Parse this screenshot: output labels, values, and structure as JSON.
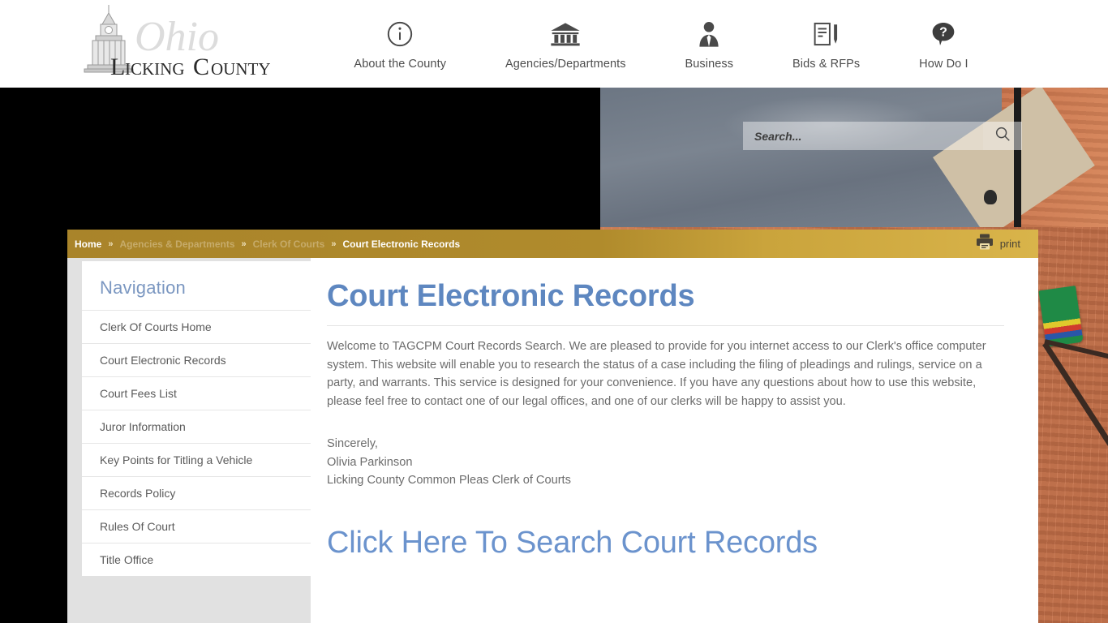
{
  "site": {
    "logo_line1": "Ohio",
    "logo_line2_a": "L",
    "logo_line2_b": "ICKING",
    "logo_line2_c": "C",
    "logo_line2_d": "OUNTY",
    "logo_alt": "Licking County Ohio"
  },
  "topnav": {
    "items": [
      {
        "label": "About the County",
        "icon": "info-circle-icon"
      },
      {
        "label": "Agencies/Departments",
        "icon": "bank-building-icon"
      },
      {
        "label": "Business",
        "icon": "businessperson-icon"
      },
      {
        "label": "Bids & RFPs",
        "icon": "document-pen-icon"
      },
      {
        "label": "How Do I",
        "icon": "question-speech-icon"
      }
    ]
  },
  "search": {
    "placeholder": "Search...",
    "value": "",
    "icon": "magnifier-icon"
  },
  "breadcrumb": {
    "items": [
      {
        "label": "Home",
        "state": "link"
      },
      {
        "label": "Agencies & Departments",
        "state": "dim"
      },
      {
        "label": "Clerk Of Courts",
        "state": "dim"
      },
      {
        "label": "Court Electronic Records",
        "state": "current"
      }
    ],
    "separator": "»"
  },
  "print": {
    "label": "print",
    "icon": "printer-icon"
  },
  "sidebar": {
    "heading": "Navigation",
    "items": [
      {
        "label": "Clerk Of Courts Home"
      },
      {
        "label": "Court Electronic Records"
      },
      {
        "label": "Court Fees List"
      },
      {
        "label": "Juror Information"
      },
      {
        "label": "Key Points for Titling a Vehicle"
      },
      {
        "label": "Records Policy"
      },
      {
        "label": "Rules Of Court"
      },
      {
        "label": "Title Office"
      }
    ]
  },
  "main": {
    "title": "Court Electronic Records",
    "paragraph": "Welcome to TAGCPM Court Records Search. We are pleased to provide for you internet access to our Clerk's office computer system. This website will enable you to research the status of a case including the filing of pleadings and rulings, service on a party, and warrants. This service is designed for your convenience. If you have any questions about how to use this website, please feel free to contact one of our legal offices, and one of our clerks will be happy to assist you.",
    "signoff_1": "Sincerely,",
    "signoff_2": "Olivia Parkinson",
    "signoff_3": "Licking County Common Pleas Clerk of Courts",
    "cta_label": "Click Here To Search Court Records"
  },
  "colors": {
    "breadcrumb_gold": "#b08b2c",
    "heading_blue": "#5e87c0",
    "nav_heading_blue": "#7b97c1",
    "body_gray": "#6c6c6c",
    "panel_gray": "#e1e1e1"
  }
}
